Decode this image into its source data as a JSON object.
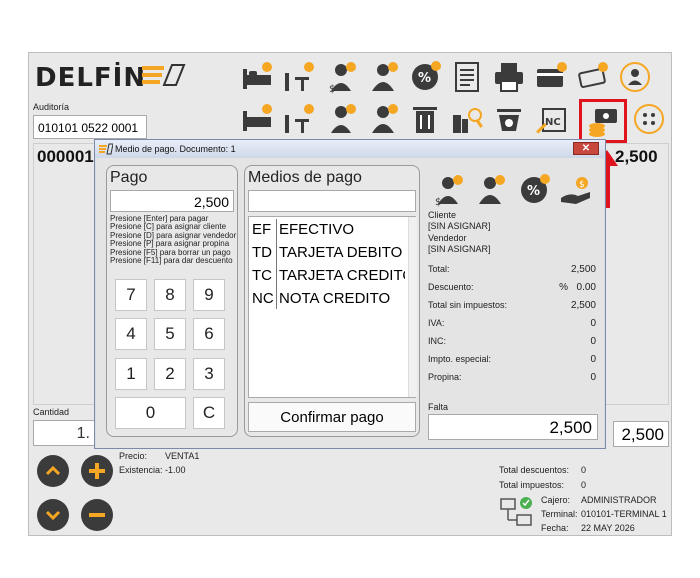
{
  "brand": {
    "name": "DELFİN"
  },
  "auditoria": {
    "label": "Auditoría",
    "value": "010101 0522 0001"
  },
  "document_number": "000001",
  "right_total": "2,500",
  "cantidad": {
    "label": "Cantidad",
    "value": "1."
  },
  "bottom_total": "2,500",
  "product": {
    "precio_label": "Precio:",
    "precio_value": "VENTA1",
    "existencia_label": "Existencia:",
    "existencia_value": "-1.00"
  },
  "totals": {
    "descuentos_label": "Total descuentos:",
    "descuentos_value": "0",
    "impuestos_label": "Total impuestos:",
    "impuestos_value": "0"
  },
  "session": {
    "cajero_label": "Cajero:",
    "cajero_value": "ADMINISTRADOR",
    "terminal_label": "Terminal:",
    "terminal_value": "010101-TERMINAL 1",
    "fecha_label": "Fecha:",
    "fecha_value": "22 MAY 2026"
  },
  "dialog": {
    "title": "Medio de pago. Documento: 1",
    "pago_title": "Pago",
    "pago_value": "2,500",
    "instructions": [
      "Presione [Enter] para pagar",
      "Presione [C] para asignar cliente",
      "Presione [D] para asignar vendedor",
      "Presione [P] para asignar propina",
      "Presione [F5] para borrar un pago",
      "Presione [F11] para dar descuento"
    ],
    "keys": [
      "7",
      "8",
      "9",
      "4",
      "5",
      "6",
      "1",
      "2",
      "3",
      "0",
      "C"
    ],
    "medios_title": "Medios de pago",
    "medios_search": "",
    "medios": [
      {
        "code": "EF",
        "name": "EFECTIVO"
      },
      {
        "code": "TD",
        "name": "TARJETA DEBITO"
      },
      {
        "code": "TC",
        "name": "TARJETA CREDITO"
      },
      {
        "code": "NC",
        "name": "NOTA CREDITO"
      }
    ],
    "confirm_label": "Confirmar pago",
    "info": {
      "cliente_label": "Cliente",
      "cliente_value": "[SIN ASIGNAR]",
      "vendedor_label": "Vendedor",
      "vendedor_value": "[SIN ASIGNAR]",
      "total_label": "Total:",
      "total_value": "2,500",
      "descuento_label": "Descuento:",
      "descuento_pct": "%",
      "descuento_value": "0.00",
      "sin_impuestos_label": "Total sin impuestos:",
      "sin_impuestos_value": "2,500",
      "iva_label": "IVA:",
      "iva_value": "0",
      "inc_label": "INC:",
      "inc_value": "0",
      "impto_label": "Impto. especial:",
      "impto_value": "0",
      "propina_label": "Propina:",
      "propina_value": "0",
      "falta_label": "Falta",
      "falta_value": "2,500"
    }
  },
  "colors": {
    "accent": "#f5a623",
    "dark_icon": "#3b3b3b",
    "highlight": "#e0141e"
  }
}
